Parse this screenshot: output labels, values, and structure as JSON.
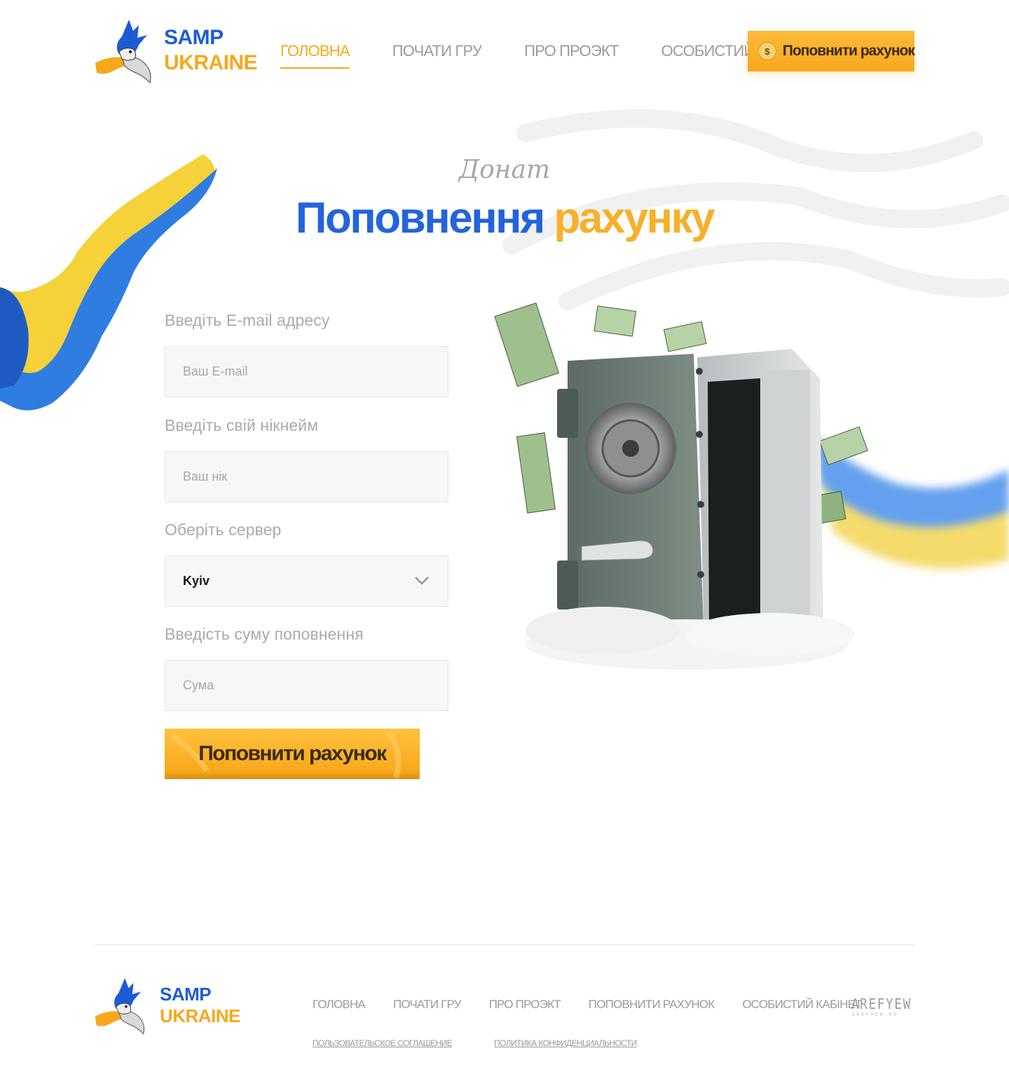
{
  "header": {
    "logo": {
      "line1": "SAMP",
      "line2": "UKRAINE"
    },
    "nav": [
      {
        "label": "Головна",
        "active": true
      },
      {
        "label": "Почати гру",
        "active": false
      },
      {
        "label": "Про проэкт",
        "active": false
      },
      {
        "label": "Особистий кабінет",
        "active": false
      }
    ],
    "topup_button": {
      "icon": "dollar-coin-icon",
      "symbol": "$",
      "label": "Поповнити рахунок"
    }
  },
  "hero": {
    "subtitle": "Донат",
    "title_part1": "Поповнення",
    "title_part2": "рахунку"
  },
  "form": {
    "email": {
      "label": "Введіть E-mail адресу",
      "placeholder": "Ваш E-mail",
      "value": ""
    },
    "nickname": {
      "label": "Введіть свій нікнейм",
      "placeholder": "Ваш нік",
      "value": ""
    },
    "server": {
      "label": "Оберіть сервер",
      "selected": "Kyiv"
    },
    "amount": {
      "label": "Введість суму поповнення",
      "placeholder": "Сума",
      "value": ""
    },
    "submit_label": "Поповнити рахунок"
  },
  "footer": {
    "logo": {
      "line1": "SAMP",
      "line2": "UKRAINE"
    },
    "nav": [
      "Головна",
      "Почати гру",
      "Про проэкт",
      "Поповнити рахунок",
      "Особистий кабінет"
    ],
    "legal": [
      "Пользовательское соглашение",
      "Политика конфиденциальности"
    ],
    "studio_mark": "AREFYEW",
    "studio_sub": "AREFYEW.RU"
  },
  "colors": {
    "brand_blue": "#2464db",
    "brand_yellow": "#f7a81c",
    "muted_text": "#9a9a9a",
    "field_bg": "#f7f7f7"
  }
}
